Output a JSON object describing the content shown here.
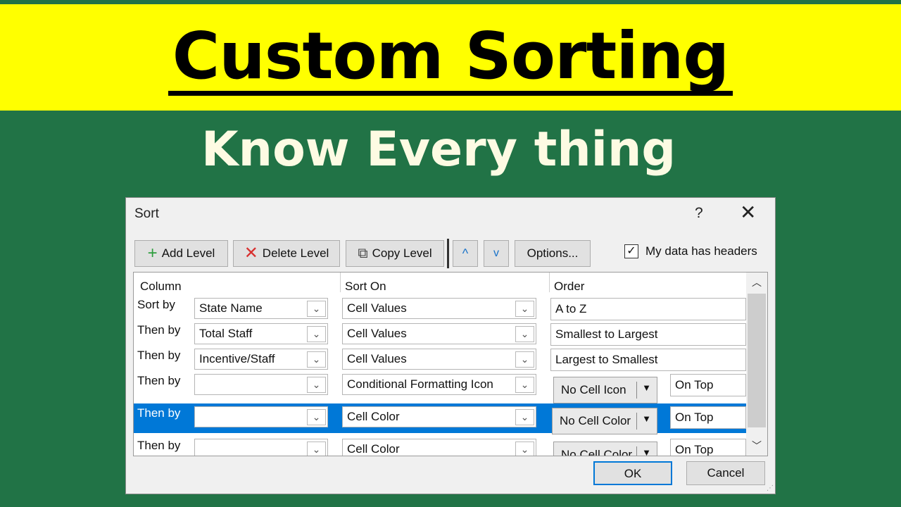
{
  "banner": {
    "title": "Custom Sorting",
    "subtitle": "Know Every thing"
  },
  "dialog": {
    "title": "Sort",
    "help": "?",
    "close": "✕",
    "toolbar": {
      "add_level": "Add Level",
      "delete_level": "Delete Level",
      "copy_level": "Copy Level",
      "move_up": "^",
      "move_down": "v",
      "options": "Options..."
    },
    "headers_checkbox": {
      "label": "My data has headers",
      "checked": true,
      "mark": "✓"
    },
    "columns": {
      "column": "Column",
      "sort_on": "Sort On",
      "order": "Order"
    },
    "rows": [
      {
        "label": "Sort by",
        "column": "State Name",
        "sort_on": "Cell Values",
        "order": "A to Z"
      },
      {
        "label": "Then by",
        "column": "Total Staff",
        "sort_on": "Cell Values",
        "order": "Smallest to Largest"
      },
      {
        "label": "Then by",
        "column": "Incentive/Staff",
        "sort_on": "Cell Values",
        "order": "Largest to Smallest"
      },
      {
        "label": "Then by",
        "column": "",
        "sort_on": "Conditional Formatting Icon",
        "order_button": "No Cell Icon",
        "position": "On Top"
      },
      {
        "label": "Then by",
        "column": "",
        "sort_on": "Cell Color",
        "order_button": "No Cell Color",
        "position": "On Top",
        "selected": true
      },
      {
        "label": "Then by",
        "column": "",
        "sort_on": "Cell Color",
        "order_button": "No Cell Color",
        "position": "On Top"
      }
    ],
    "ok": "OK",
    "cancel": "Cancel"
  }
}
